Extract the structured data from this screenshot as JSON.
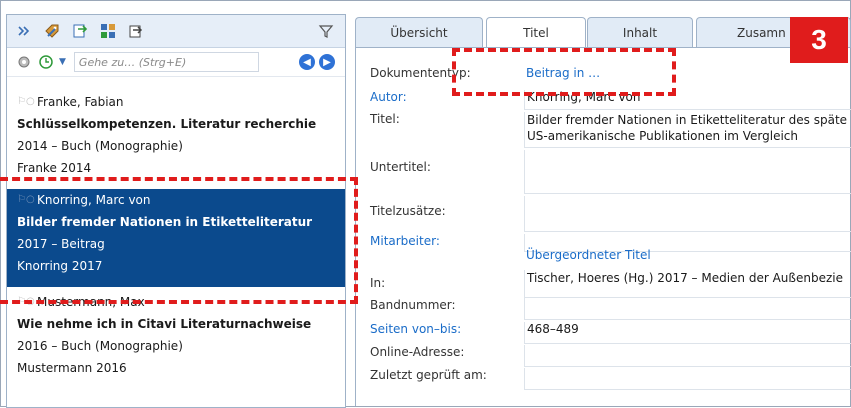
{
  "toolbar": {
    "icons": [
      "double-chevron-icon",
      "tag-pencil-icon",
      "import-icon",
      "grid-icon",
      "export-icon",
      "filter-icon"
    ]
  },
  "search": {
    "placeholder": "Gehe zu… (Strg+E)"
  },
  "references": [
    {
      "author": "Franke, Fabian",
      "title": "Schlüsselkompetenzen. Literatur recherchie",
      "meta": "2014 – Buch (Monographie)",
      "short": "Franke 2014",
      "selected": false
    },
    {
      "author": "Knorring, Marc von",
      "title": "Bilder fremder Nationen in Etiketteliteratur",
      "meta": "2017 – Beitrag",
      "short": "Knorring 2017",
      "selected": true
    },
    {
      "author": "Mustermann, Max",
      "title": "Wie nehme ich in Citavi Literaturnachweise",
      "meta": "2016 – Buch (Monographie)",
      "short": "Mustermann 2016",
      "selected": false
    }
  ],
  "tabs": [
    "Übersicht",
    "Titel",
    "Inhalt",
    "Zusamn"
  ],
  "active_tab": "Titel",
  "fields": {
    "dokumententyp": {
      "label": "Dokumententyp:",
      "value": "Beitrag in …"
    },
    "autor": {
      "label": "Autor:",
      "value": "Knorring, Marc von"
    },
    "titel": {
      "label": "Titel:",
      "value_line1": "Bilder fremder Nationen in Etiketteliteratur des späte",
      "value_line2": "US-amerikanische Publikationen im Vergleich"
    },
    "untertitel": {
      "label": "Untertitel:",
      "value": ""
    },
    "titelzusaetze": {
      "label": "Titelzusätze:",
      "value": ""
    },
    "mitarbeiter": {
      "label": "Mitarbeiter:",
      "value": ""
    },
    "uebergeordneter_titel": {
      "value": "Übergeordneter Titel"
    },
    "in": {
      "label": "In:",
      "value": "Tischer, Hoeres (Hg.) 2017 – Medien der Außenbezie"
    },
    "bandnummer": {
      "label": "Bandnummer:",
      "value": ""
    },
    "seiten": {
      "label": "Seiten von–bis:",
      "value": "468–489"
    },
    "online_adresse": {
      "label": "Online-Adresse:",
      "value": ""
    },
    "zuletzt_geprueft": {
      "label": "Zuletzt geprüft am:",
      "value": ""
    }
  },
  "annotation": {
    "step": "3"
  },
  "colors": {
    "selection": "#0b4a8d",
    "link": "#1a6cc8",
    "annotation_red": "#e01c1c"
  }
}
